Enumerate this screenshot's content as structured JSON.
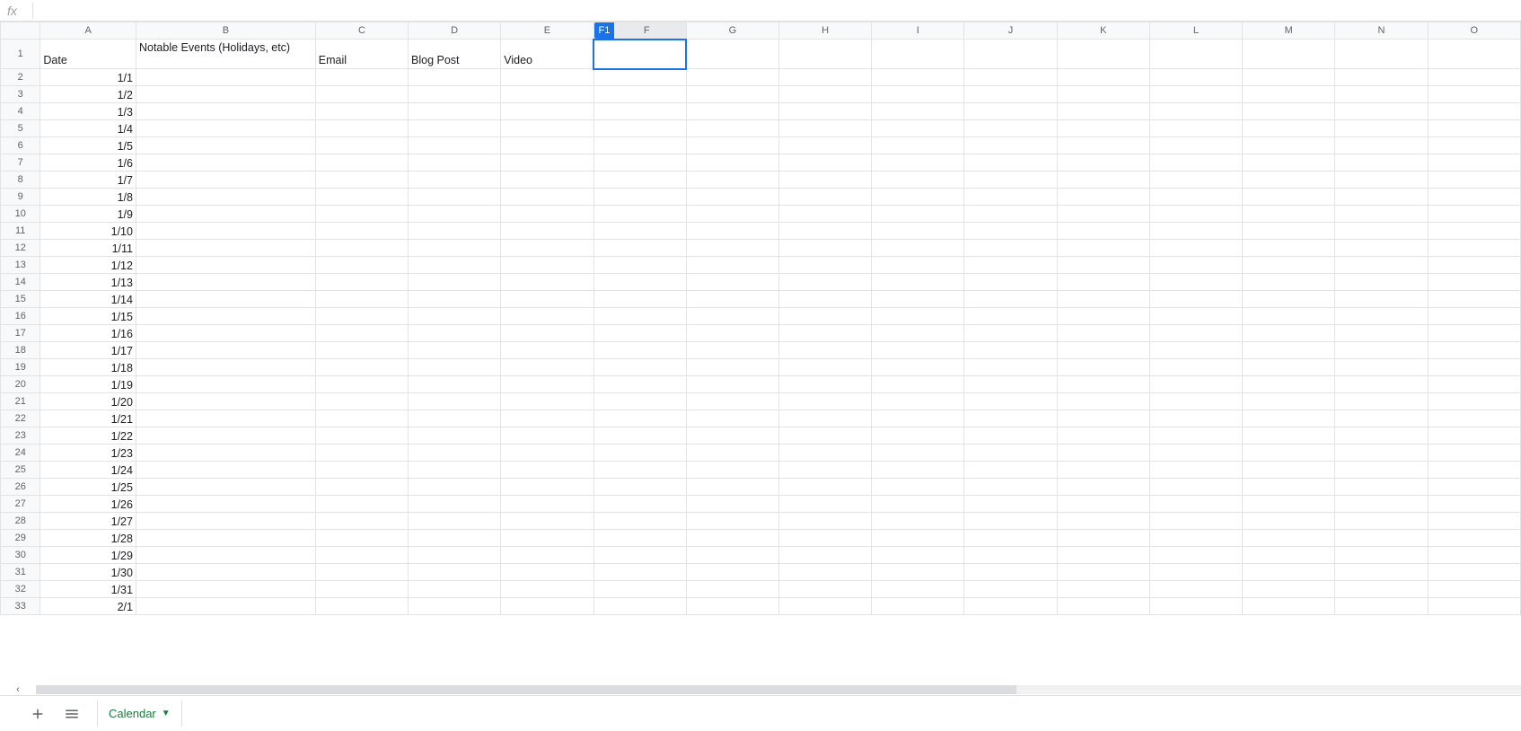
{
  "formula_bar": {
    "fx_label": "fx",
    "value": ""
  },
  "name_box": "F1",
  "columns": [
    "A",
    "B",
    "C",
    "D",
    "E",
    "F",
    "G",
    "H",
    "I",
    "J",
    "K",
    "L",
    "M",
    "N",
    "O"
  ],
  "selected_column": "F",
  "selected_cell": "F1",
  "row_count": 33,
  "header_row": {
    "A": "Date",
    "B": "Notable Events (Holidays, etc)",
    "C": "Email",
    "D": "Blog Post",
    "E": "Video",
    "F": ""
  },
  "date_values": [
    "1/1",
    "1/2",
    "1/3",
    "1/4",
    "1/5",
    "1/6",
    "1/7",
    "1/8",
    "1/9",
    "1/10",
    "1/11",
    "1/12",
    "1/13",
    "1/14",
    "1/15",
    "1/16",
    "1/17",
    "1/18",
    "1/19",
    "1/20",
    "1/21",
    "1/22",
    "1/23",
    "1/24",
    "1/25",
    "1/26",
    "1/27",
    "1/28",
    "1/29",
    "1/30",
    "1/31",
    "2/1"
  ],
  "sheet_tabs": {
    "active": "Calendar"
  }
}
